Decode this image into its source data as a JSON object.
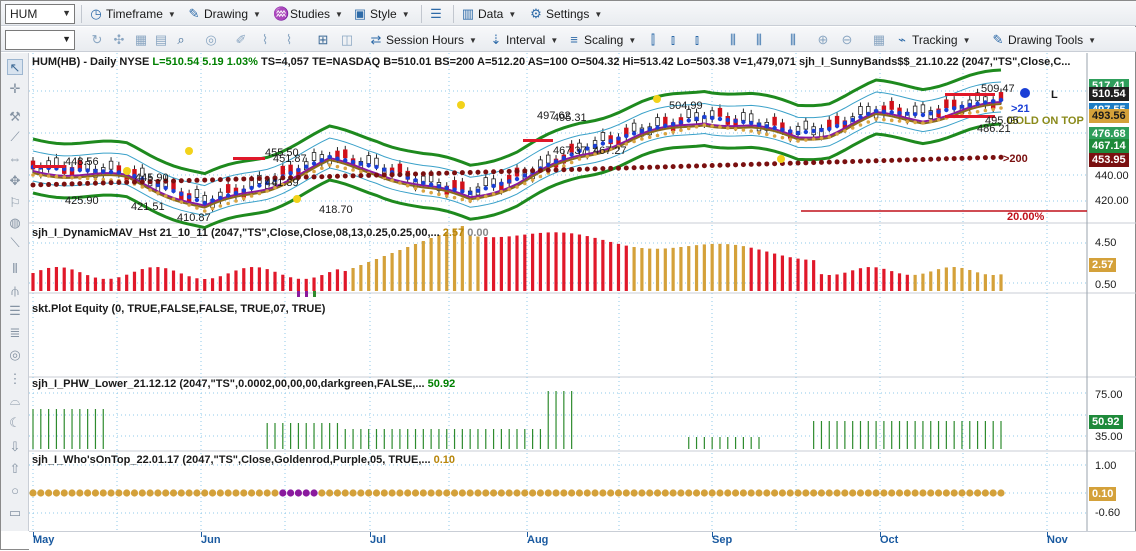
{
  "toolbar": {
    "symbol": "HUM",
    "items": [
      "Timeframe",
      "Drawing",
      "Studies",
      "Style",
      "Data",
      "Settings"
    ],
    "items2": [
      "Session Hours",
      "Interval",
      "Scaling",
      "Tracking",
      "Drawing Tools"
    ]
  },
  "price_pane": {
    "title": "HUM(HB) - Daily  NYSE",
    "L": "L=510.54",
    "chg": "5.19",
    "pct": "1.03%",
    "rest": "TS=4,057  TE=NASDAQ  B=510.01  BS=200  A=512.20  AS=100  O=504.32  Hi=513.42  Lo=503.38  V=1,479,071",
    "study": "sjh_I_SunnyBands$$_21.10.22 (2047,\"TS\",Close,C...",
    "axis_labels": [
      "440.00",
      "420.00"
    ],
    "tags": [
      {
        "text": "517.41",
        "bg": "#2e9e5b",
        "fg": "#ffffff"
      },
      {
        "text": "510.54",
        "bg": "#1f1f1f",
        "fg": "#ffffff"
      },
      {
        "text": "497.55",
        "bg": "#1c7cc4",
        "fg": "#ffffff"
      },
      {
        "text": "493.56",
        "bg": "#d4a13a",
        "fg": "#1a1a1a"
      },
      {
        "text": "476.68",
        "bg": "#2e9e5b",
        "fg": "#ffffff"
      },
      {
        "text": "467.14",
        "bg": "#1e8a3a",
        "fg": "#ffffff"
      },
      {
        "text": "453.95",
        "bg": "#7a1010",
        "fg": "#ffffff"
      }
    ],
    "annotations": {
      "l": "L",
      "gt21": ">21",
      "gt200": ">200",
      "gold_on_top": "GOLD ON TOP",
      "pct20": "20.00%",
      "p448": "448.56",
      "p445": "445.90",
      "p425": "425.90",
      "p421": "421.51",
      "p410": "410.87",
      "p455": "455.50",
      "p451": "451.87",
      "p441": "441.39",
      "p418": "418.70",
      "p497": "497.62",
      "p495": "495.31",
      "p467a": "467.37",
      "p467b": "467.27",
      "p504": "504.99",
      "p509": "509.47",
      "p495b": "495.05",
      "p486": "486.21"
    }
  },
  "mav_pane": {
    "title": "sjh_I_DynamicMAV_Hst 21_10_11 (2047,\"TS\",Close,Close,08,13,0.25,0.25,00,...",
    "v1": "2.57",
    "v2": "0.00",
    "axis_labels": [
      "4.50",
      "0.50"
    ],
    "tag": "2.57"
  },
  "equity_pane": {
    "title": "skt.Plot Equity (0, TRUE,FALSE,FALSE, TRUE,07, TRUE)"
  },
  "phw_pane": {
    "title": "sjh_I_PHW_Lower_21.12.12 (2047,\"TS\",0.0002,00,00,00,darkgreen,FALSE,...",
    "v1": "50.92",
    "axis_labels": [
      "75.00",
      "35.00"
    ],
    "tag": "50.92"
  },
  "who_pane": {
    "title": "sjh_I_Who'sOnTop_22.01.17 (2047,\"TS\",Close,Goldenrod,Purple,05, TRUE,...",
    "v1": "0.10",
    "axis_labels": [
      "1.00",
      "-0.60"
    ],
    "tag": "0.10"
  },
  "date_axis": [
    "May",
    "Jun",
    "Jul",
    "Aug",
    "Sep",
    "Oct",
    "Nov"
  ],
  "colors": {
    "band_green": "#1e8a1e",
    "blue_dots": "#1a3fd6",
    "gold_dots": "#d9a441",
    "maroon_dots": "#7a1010",
    "hist_red": "#e0182a",
    "hist_gold": "#d4a13a",
    "phw_green": "#2e8b2e",
    "who_gold": "#d4a13a",
    "who_purple": "#8a1a9e"
  }
}
